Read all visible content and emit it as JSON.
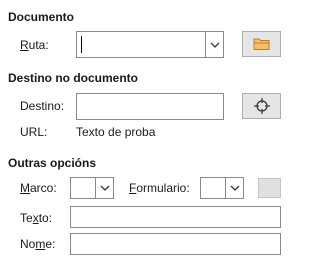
{
  "document_section": {
    "heading": "Documento",
    "path_label_underlined": "R",
    "path_label_rest": "uta:",
    "path_value": ""
  },
  "target_section": {
    "heading": "Destino no documento",
    "target_label": "Destino:",
    "target_value": "",
    "url_label": "URL:",
    "url_value": "Texto de proba"
  },
  "other_section": {
    "heading": "Outras opcións",
    "frame_label_underlined": "M",
    "frame_label_rest": "arco:",
    "frame_value": "",
    "form_label_underlined": "F",
    "form_label_rest": "ormulario:",
    "form_value": "",
    "text_label_pre": "Te",
    "text_label_underlined": "x",
    "text_label_post": "to:",
    "text_value": "",
    "name_label_pre": "No",
    "name_label_underlined": "m",
    "name_label_post": "e:",
    "name_value": ""
  },
  "icons": {
    "open_file": "folder-icon",
    "target": "crosshair-icon",
    "events": "events-icon"
  },
  "colors": {
    "folder_fill": "#f5c06a",
    "folder_stroke": "#c07c1f",
    "border": "#8a8a8a",
    "button_bg": "#e5e5e5"
  }
}
